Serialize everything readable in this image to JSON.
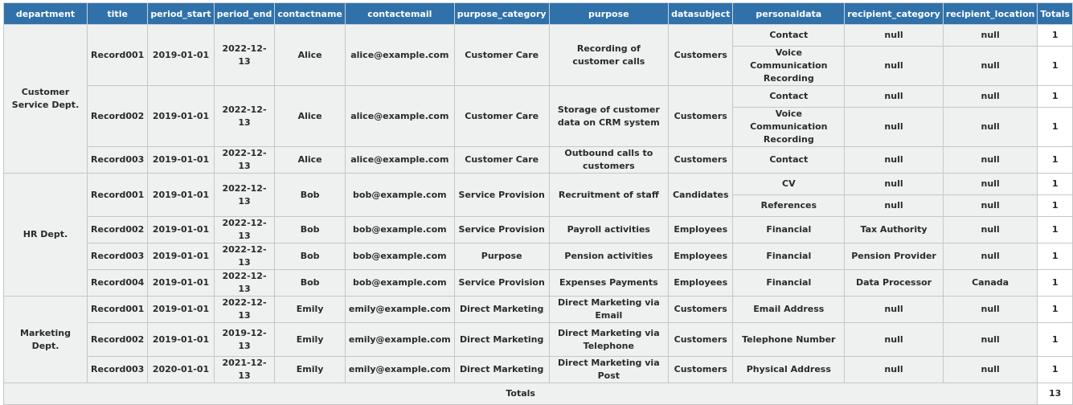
{
  "columns": [
    "department",
    "title",
    "period_start",
    "period_end",
    "contactname",
    "contactemail",
    "purpose_category",
    "purpose",
    "datasubject",
    "personaldata",
    "recipient_category",
    "recipient_location",
    "Totals"
  ],
  "departments": [
    {
      "name": "Customer Service Dept.",
      "records": [
        {
          "title": "Record001",
          "period_start": "2019-01-01",
          "period_end": "2022-12-13",
          "contactname": "Alice",
          "contactemail": "alice@example.com",
          "purpose_category": "Customer Care",
          "purpose": "Recording of customer calls",
          "datasubject": "Customers",
          "items": [
            {
              "personaldata": "Contact",
              "recipient_category": "null",
              "recipient_location": "null",
              "total": "1"
            },
            {
              "personaldata": "Voice Communication Recording",
              "recipient_category": "null",
              "recipient_location": "null",
              "total": "1"
            }
          ]
        },
        {
          "title": "Record002",
          "period_start": "2019-01-01",
          "period_end": "2022-12-13",
          "contactname": "Alice",
          "contactemail": "alice@example.com",
          "purpose_category": "Customer Care",
          "purpose": "Storage of customer data on CRM system",
          "datasubject": "Customers",
          "items": [
            {
              "personaldata": "Contact",
              "recipient_category": "null",
              "recipient_location": "null",
              "total": "1"
            },
            {
              "personaldata": "Voice Communication Recording",
              "recipient_category": "null",
              "recipient_location": "null",
              "total": "1"
            }
          ]
        },
        {
          "title": "Record003",
          "period_start": "2019-01-01",
          "period_end": "2022-12-13",
          "contactname": "Alice",
          "contactemail": "alice@example.com",
          "purpose_category": "Customer Care",
          "purpose": "Outbound calls to customers",
          "datasubject": "Customers",
          "items": [
            {
              "personaldata": "Contact",
              "recipient_category": "null",
              "recipient_location": "null",
              "total": "1"
            }
          ]
        }
      ]
    },
    {
      "name": "HR Dept.",
      "records": [
        {
          "title": "Record001",
          "period_start": "2019-01-01",
          "period_end": "2022-12-13",
          "contactname": "Bob",
          "contactemail": "bob@example.com",
          "purpose_category": "Service Provision",
          "purpose": "Recruitment of staff",
          "datasubject": "Candidates",
          "items": [
            {
              "personaldata": "CV",
              "recipient_category": "null",
              "recipient_location": "null",
              "total": "1"
            },
            {
              "personaldata": "References",
              "recipient_category": "null",
              "recipient_location": "null",
              "total": "1"
            }
          ]
        },
        {
          "title": "Record002",
          "period_start": "2019-01-01",
          "period_end": "2022-12-13",
          "contactname": "Bob",
          "contactemail": "bob@example.com",
          "purpose_category": "Service Provision",
          "purpose": "Payroll activities",
          "datasubject": "Employees",
          "items": [
            {
              "personaldata": "Financial",
              "recipient_category": "Tax Authority",
              "recipient_location": "null",
              "total": "1"
            }
          ]
        },
        {
          "title": "Record003",
          "period_start": "2019-01-01",
          "period_end": "2022-12-13",
          "contactname": "Bob",
          "contactemail": "bob@example.com",
          "purpose_category": "Purpose",
          "purpose": "Pension activities",
          "datasubject": "Employees",
          "items": [
            {
              "personaldata": "Financial",
              "recipient_category": "Pension Provider",
              "recipient_location": "null",
              "total": "1"
            }
          ]
        },
        {
          "title": "Record004",
          "period_start": "2019-01-01",
          "period_end": "2022-12-13",
          "contactname": "Bob",
          "contactemail": "bob@example.com",
          "purpose_category": "Service Provision",
          "purpose": "Expenses Payments",
          "datasubject": "Employees",
          "items": [
            {
              "personaldata": "Financial",
              "recipient_category": "Data Processor",
              "recipient_location": "Canada",
              "total": "1"
            }
          ]
        }
      ]
    },
    {
      "name": "Marketing Dept.",
      "records": [
        {
          "title": "Record001",
          "period_start": "2019-01-01",
          "period_end": "2022-12-13",
          "contactname": "Emily",
          "contactemail": "emily@example.com",
          "purpose_category": "Direct Marketing",
          "purpose": "Direct Marketing via Email",
          "datasubject": "Customers",
          "items": [
            {
              "personaldata": "Email Address",
              "recipient_category": "null",
              "recipient_location": "null",
              "total": "1"
            }
          ]
        },
        {
          "title": "Record002",
          "period_start": "2019-01-01",
          "period_end": "2019-12-13",
          "contactname": "Emily",
          "contactemail": "emily@example.com",
          "purpose_category": "Direct Marketing",
          "purpose": "Direct Marketing via Telephone",
          "datasubject": "Customers",
          "items": [
            {
              "personaldata": "Telephone Number",
              "recipient_category": "null",
              "recipient_location": "null",
              "total": "1"
            }
          ]
        },
        {
          "title": "Record003",
          "period_start": "2020-01-01",
          "period_end": "2021-12-13",
          "contactname": "Emily",
          "contactemail": "emily@example.com",
          "purpose_category": "Direct Marketing",
          "purpose": "Direct Marketing via Post",
          "datasubject": "Customers",
          "items": [
            {
              "personaldata": "Physical Address",
              "recipient_category": "null",
              "recipient_location": "null",
              "total": "1"
            }
          ]
        }
      ]
    }
  ],
  "grand_total": {
    "label": "Totals",
    "value": "13"
  }
}
